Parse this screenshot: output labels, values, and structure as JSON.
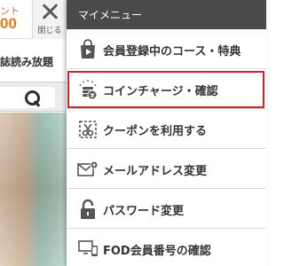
{
  "background": {
    "point_label": "ント",
    "point_value": "00",
    "close_label": "閉じる",
    "tab_text": "誌読み放題"
  },
  "menu": {
    "title": "マイメニュー",
    "items": [
      {
        "label": "会員登録中のコース・特典",
        "icon": "shopping-bag-play-icon"
      },
      {
        "label": "コインチャージ・確認",
        "icon": "coin-stack-icon"
      },
      {
        "label": "クーポンを利用する",
        "icon": "coupon-scissors-icon"
      },
      {
        "label": "メールアドレス変更",
        "icon": "mail-gear-icon"
      },
      {
        "label": "パスワード変更",
        "icon": "padlock-icon"
      },
      {
        "label": "FOD会員番号の確認",
        "icon": "devices-icon"
      }
    ],
    "highlighted_item": "コインチャージ・確認"
  },
  "colors": {
    "menu_header": "#4a4a4a",
    "highlight_border": "#d81e24",
    "point_value": "#e8761e",
    "icon": "#555555"
  }
}
